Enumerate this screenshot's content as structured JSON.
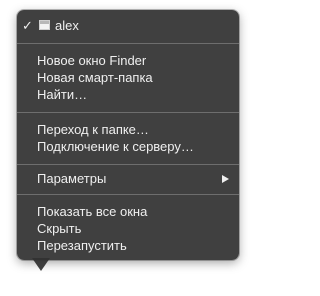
{
  "dock_menu": {
    "window_item": {
      "check": "✓",
      "label": "alex",
      "icon": "finder-window-icon"
    },
    "group_finder": [
      {
        "name": "menu-item-new-finder-window",
        "label": "Новое окно Finder"
      },
      {
        "name": "menu-item-new-smart-folder",
        "label": "Новая смарт-папка"
      },
      {
        "name": "menu-item-find",
        "label": "Найти…"
      }
    ],
    "group_navigation": [
      {
        "name": "menu-item-go-to-folder",
        "label": "Переход к папке…"
      },
      {
        "name": "menu-item-connect-to-server",
        "label": "Подключение к серверу…"
      }
    ],
    "options": {
      "label": "Параметры",
      "icon": "submenu-arrow-icon"
    },
    "group_app": [
      {
        "name": "menu-item-show-all-windows",
        "label": "Показать все окна"
      },
      {
        "name": "menu-item-hide",
        "label": "Скрыть"
      },
      {
        "name": "menu-item-relaunch",
        "label": "Перезапустить"
      }
    ]
  },
  "colors": {
    "menu_bg": "#323232",
    "text": "#efefef",
    "separator": "#6e6e6e"
  }
}
